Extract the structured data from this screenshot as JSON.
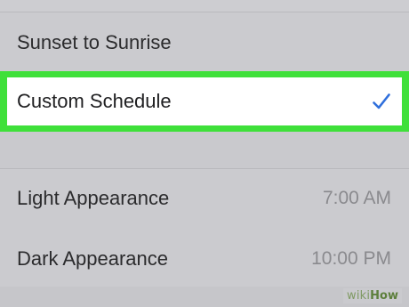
{
  "schedule_options": {
    "sunset_to_sunrise": "Sunset to Sunrise",
    "custom_schedule": "Custom Schedule"
  },
  "custom_schedule_times": {
    "light_label": "Light Appearance",
    "light_value": "7:00 AM",
    "dark_label": "Dark Appearance",
    "dark_value": "10:00 PM"
  },
  "watermark": {
    "wiki": "wiki",
    "how": "How"
  },
  "colors": {
    "highlight": "#3fe03a",
    "checkmark": "#2f6fdc",
    "background": "#cdcdd1"
  },
  "icons": {
    "selected": "checkmark-icon"
  }
}
